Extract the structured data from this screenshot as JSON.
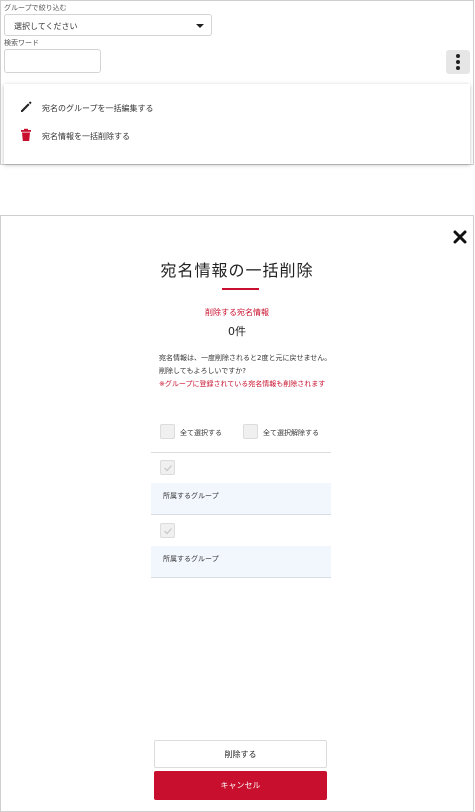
{
  "filter": {
    "group_label": "グループで絞り込む",
    "group_select_value": "選択してください",
    "search_label": "検索ワード",
    "search_value": "",
    "search_placeholder": ""
  },
  "menu": {
    "items": [
      {
        "label": "宛名のグループを一括編集する",
        "icon": "pencil-icon"
      },
      {
        "label": "宛名情報を一括削除する",
        "icon": "trash-icon"
      }
    ]
  },
  "modal": {
    "title": "宛名情報の一括削除",
    "section_label": "削除する宛名情報",
    "count": "0件",
    "warning_text": "宛名情報は、一度削除されると2度と元に戻せません。削除してもよろしいですか?",
    "warning_red": "※グループに登録されている宛名情報も削除されます",
    "select_all_label": "全て選択する",
    "deselect_all_label": "全て選択解除する",
    "records": [
      {
        "group_label": "所属するグループ"
      },
      {
        "group_label": "所属するグループ"
      }
    ],
    "delete_label": "削除する",
    "cancel_label": "キャンセル"
  },
  "colors": {
    "accent": "#c8102e",
    "group_box_bg": "#f2f6fd"
  }
}
